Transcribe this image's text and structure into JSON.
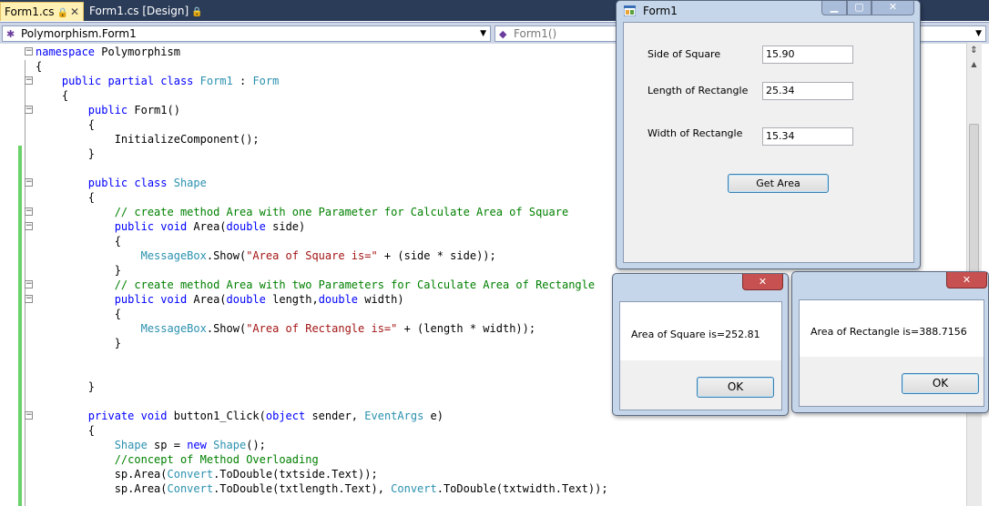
{
  "tabs": [
    {
      "label": "Form1.cs",
      "close": "✕"
    },
    {
      "label": "Form1.cs [Design]"
    }
  ],
  "nav": {
    "class_combo": "Polymorphism.Form1",
    "member_combo": "Form1()"
  },
  "code": {
    "lines": [
      [
        {
          "t": "namespace ",
          "c": "kw"
        },
        {
          "t": "Polymorphism",
          "c": ""
        }
      ],
      [
        {
          "t": "{",
          "c": ""
        }
      ],
      [
        {
          "t": "    ",
          "c": ""
        },
        {
          "t": "public partial class ",
          "c": "kw"
        },
        {
          "t": "Form1",
          "c": "ty"
        },
        {
          "t": " : ",
          "c": ""
        },
        {
          "t": "Form",
          "c": "ty"
        }
      ],
      [
        {
          "t": "    {",
          "c": ""
        }
      ],
      [
        {
          "t": "        ",
          "c": ""
        },
        {
          "t": "public ",
          "c": "kw"
        },
        {
          "t": "Form1()",
          "c": ""
        }
      ],
      [
        {
          "t": "        {",
          "c": ""
        }
      ],
      [
        {
          "t": "            InitializeComponent();",
          "c": ""
        }
      ],
      [
        {
          "t": "        }",
          "c": ""
        }
      ],
      [
        {
          "t": "",
          "c": ""
        }
      ],
      [
        {
          "t": "        ",
          "c": ""
        },
        {
          "t": "public class ",
          "c": "kw"
        },
        {
          "t": "Shape",
          "c": "ty"
        }
      ],
      [
        {
          "t": "        {",
          "c": ""
        }
      ],
      [
        {
          "t": "            ",
          "c": ""
        },
        {
          "t": "// create method Area with one Parameter for Calculate Area of Square",
          "c": "cm"
        }
      ],
      [
        {
          "t": "            ",
          "c": ""
        },
        {
          "t": "public void ",
          "c": "kw"
        },
        {
          "t": "Area(",
          "c": ""
        },
        {
          "t": "double",
          "c": "kw"
        },
        {
          "t": " side)",
          "c": ""
        }
      ],
      [
        {
          "t": "            {",
          "c": ""
        }
      ],
      [
        {
          "t": "                ",
          "c": ""
        },
        {
          "t": "MessageBox",
          "c": "ty"
        },
        {
          "t": ".Show(",
          "c": ""
        },
        {
          "t": "\"Area of Square is=\"",
          "c": "st"
        },
        {
          "t": " + (side * side));",
          "c": ""
        }
      ],
      [
        {
          "t": "            }",
          "c": ""
        }
      ],
      [
        {
          "t": "            ",
          "c": ""
        },
        {
          "t": "// create method Area with two Parameters for Calculate Area of Rectangle",
          "c": "cm"
        }
      ],
      [
        {
          "t": "            ",
          "c": ""
        },
        {
          "t": "public void ",
          "c": "kw"
        },
        {
          "t": "Area(",
          "c": ""
        },
        {
          "t": "double",
          "c": "kw"
        },
        {
          "t": " length,",
          "c": ""
        },
        {
          "t": "double",
          "c": "kw"
        },
        {
          "t": " width)",
          "c": ""
        }
      ],
      [
        {
          "t": "            {",
          "c": ""
        }
      ],
      [
        {
          "t": "                ",
          "c": ""
        },
        {
          "t": "MessageBox",
          "c": "ty"
        },
        {
          "t": ".Show(",
          "c": ""
        },
        {
          "t": "\"Area of Rectangle is=\"",
          "c": "st"
        },
        {
          "t": " + (length * width));",
          "c": ""
        }
      ],
      [
        {
          "t": "            }",
          "c": ""
        }
      ],
      [
        {
          "t": "",
          "c": ""
        }
      ],
      [
        {
          "t": "",
          "c": ""
        }
      ],
      [
        {
          "t": "        }",
          "c": ""
        }
      ],
      [
        {
          "t": "",
          "c": ""
        }
      ],
      [
        {
          "t": "        ",
          "c": ""
        },
        {
          "t": "private void ",
          "c": "kw"
        },
        {
          "t": "button1_Click(",
          "c": ""
        },
        {
          "t": "object",
          "c": "kw"
        },
        {
          "t": " sender, ",
          "c": ""
        },
        {
          "t": "EventArgs",
          "c": "ty"
        },
        {
          "t": " e)",
          "c": ""
        }
      ],
      [
        {
          "t": "        {",
          "c": ""
        }
      ],
      [
        {
          "t": "            ",
          "c": ""
        },
        {
          "t": "Shape",
          "c": "ty"
        },
        {
          "t": " sp = ",
          "c": ""
        },
        {
          "t": "new ",
          "c": "kw"
        },
        {
          "t": "Shape",
          "c": "ty"
        },
        {
          "t": "();",
          "c": ""
        }
      ],
      [
        {
          "t": "            ",
          "c": ""
        },
        {
          "t": "//concept of Method Overloading",
          "c": "cm"
        }
      ],
      [
        {
          "t": "            sp.Area(",
          "c": ""
        },
        {
          "t": "Convert",
          "c": "ty"
        },
        {
          "t": ".ToDouble(txtside.Text));",
          "c": ""
        }
      ],
      [
        {
          "t": "            sp.Area(",
          "c": ""
        },
        {
          "t": "Convert",
          "c": "ty"
        },
        {
          "t": ".ToDouble(txtlength.Text), ",
          "c": ""
        },
        {
          "t": "Convert",
          "c": "ty"
        },
        {
          "t": ".ToDouble(txtwidth.Text));",
          "c": ""
        }
      ]
    ]
  },
  "form1": {
    "title": "Form1",
    "side_label": "Side of Square",
    "side_value": "15.90",
    "length_label": "Length of Rectangle",
    "length_value": "25.34",
    "width_label": "Width of Rectangle",
    "width_value": "15.34",
    "button_label": "Get Area"
  },
  "msg_square": {
    "text": "Area of Square is=252.81",
    "ok": "OK"
  },
  "msg_rect": {
    "text": "Area of Rectangle is=388.7156",
    "ok": "OK"
  },
  "colors": {
    "keyword": "#0000ff",
    "type": "#2b91af",
    "comment": "#008000",
    "string": "#a31515",
    "active_tab": "#fff1b3",
    "tab_bar": "#2b3c59"
  }
}
